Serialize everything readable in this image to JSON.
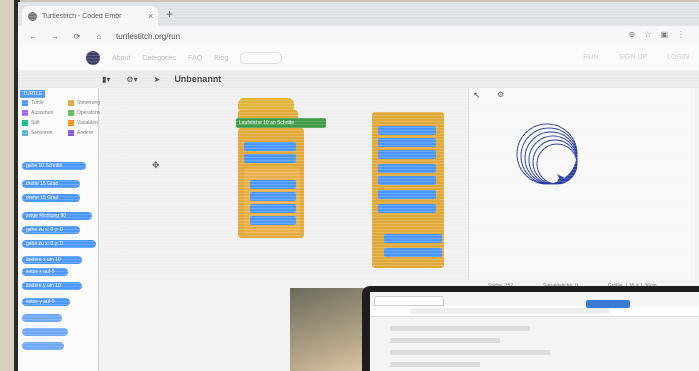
{
  "browser": {
    "tab_title": "Turtlestitch - Coded Embr",
    "tab_close": "×",
    "new_tab": "+",
    "url": "turtlestitch.org/run"
  },
  "site_nav": {
    "items": [
      "About",
      "Categories",
      "FAQ",
      "Blog"
    ],
    "run": "RUN",
    "signup": "SIGN UP",
    "login": "LOGIN"
  },
  "editor": {
    "project_title": "Unbenannt",
    "status": {
      "stiche": "Stiche: 752",
      "sprunge": "Sprungstiche: 0",
      "grosse": "Größe: 1.35 × 1.36cm"
    }
  },
  "palette": {
    "tab": "TURTLE",
    "categories": [
      {
        "label": "Turtle",
        "color": "#4c97ff"
      },
      {
        "label": "Steuerung",
        "color": "#e0a93a"
      },
      {
        "label": "Aussehen",
        "color": "#9966ff"
      },
      {
        "label": "Operatoren",
        "color": "#59c059"
      },
      {
        "label": "Stift",
        "color": "#0fbd8c"
      },
      {
        "label": "Variablen",
        "color": "#ff8c1a"
      },
      {
        "label": "Sensoren",
        "color": "#5cb1d6"
      },
      {
        "label": "Andere",
        "color": "#8a55d7"
      }
    ],
    "blocks": [
      "gehe 10 Schritte",
      "drehe 15 Grad",
      "drehe 15 Grad",
      "zeige Richtung 90",
      "gehe zu x: 0 y: 0",
      "gehe zu x: 0 y: 0",
      "ändere x um 10",
      "setze x auf 0",
      "ändere y um 10",
      "setze y auf 0"
    ]
  },
  "script_block": "Laufstiche 10 an Schritte"
}
